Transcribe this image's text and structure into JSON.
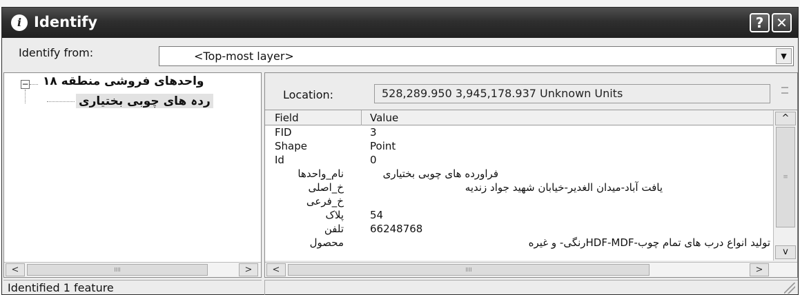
{
  "window": {
    "title": "Identify",
    "help_label": "?",
    "close_label": "✕",
    "info_icon": "i"
  },
  "identify_from": {
    "label": "Identify from:",
    "value": "<Top-most layer>",
    "arrow": "▼"
  },
  "tree": {
    "expander": "−",
    "layer": "واحدهای فروشی منطقه ۱۸",
    "feature": "ردہ های چوبی بختیاری"
  },
  "location": {
    "label": "Location:",
    "value": "528,289.950  3,945,178.937 Unknown Units"
  },
  "grid": {
    "header": {
      "field": "Field",
      "value": "Value"
    },
    "rows": [
      {
        "field": "FID",
        "value": "3"
      },
      {
        "field": "Shape",
        "value": "Point"
      },
      {
        "field": "Id",
        "value": "0"
      },
      {
        "field": "نام_واحدها",
        "value": "فراورده های چوبی بختیاری"
      },
      {
        "field": "خ_اصلی",
        "value": "یافت آباد-میدان الغدیر-خیابان شهید جواد زندیه"
      },
      {
        "field": "خ_فرعی",
        "value": ""
      },
      {
        "field": "پلاک",
        "value": "54"
      },
      {
        "field": "تلفن",
        "value": "66248768"
      },
      {
        "field": "محصول",
        "value": "تولید انواع درب های تمام چوب-HDF-MDFرنگی- و غیره"
      }
    ]
  },
  "scroll": {
    "left": "<",
    "right": ">",
    "up": "^",
    "down": "v",
    "thumb": "IIII"
  },
  "status": {
    "text": "Identified 1 feature"
  }
}
